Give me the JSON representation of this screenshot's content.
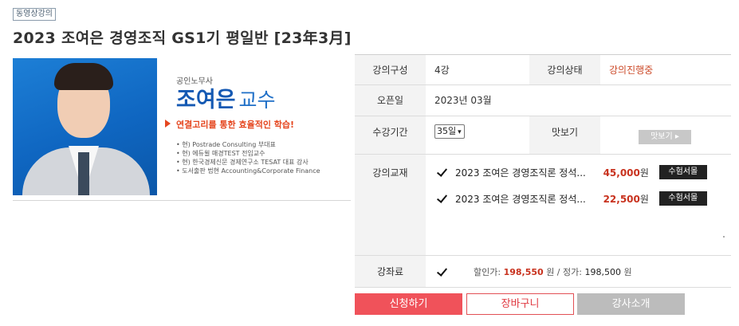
{
  "header": {
    "badge": "동영상강의",
    "title": "2023 조여은 경영조직 GS1기 평일반 [23年3月]"
  },
  "banner": {
    "subtitle": "공인노무사",
    "name": "조여은",
    "title_suffix": "교수",
    "slogan": "연결고리를 통한 효율적인 학습!",
    "career": [
      "• 현) Postrade Consulting 부대표",
      "• 현) 에듀윌 매경TEST 전임교수",
      "• 현) 한국경제신문 경제연구소 TESAT 대표 강사",
      "• 도서출판 법현 Accounting&Corporate Finance"
    ]
  },
  "info": {
    "composition_label": "강의구성",
    "composition_value": "4강",
    "status_label": "강의상태",
    "status_value": "강의진행중",
    "open_label": "오픈일",
    "open_value": "2023년 03월",
    "period_label": "수강기간",
    "period_value": "35일",
    "preview_label": "맛보기",
    "preview_button": "맛보기 ▸",
    "textbook_label": "강의교재",
    "books": [
      {
        "title": "2023 조여은 경영조직론 정석...",
        "price": "45,000",
        "unit": "원",
        "publisher": "수험서몰"
      },
      {
        "title": "2023 조여은 경영조직론 정석...",
        "price": "22,500",
        "unit": "원",
        "publisher": "수험서몰"
      }
    ],
    "fee_label": "강좌료",
    "fee_discount_label": "할인가:",
    "fee_discount_value": "198,550",
    "fee_discount_unit": "원 / 정가:",
    "fee_regular_value": "198,500",
    "fee_regular_unit": "원"
  },
  "actions": {
    "apply": "신청하기",
    "cart": "장바구니",
    "instructor": "강사소개"
  },
  "colors": {
    "accent_red": "#f0525a",
    "price_red": "#c8321e",
    "banner_blue": "#1459b3"
  }
}
